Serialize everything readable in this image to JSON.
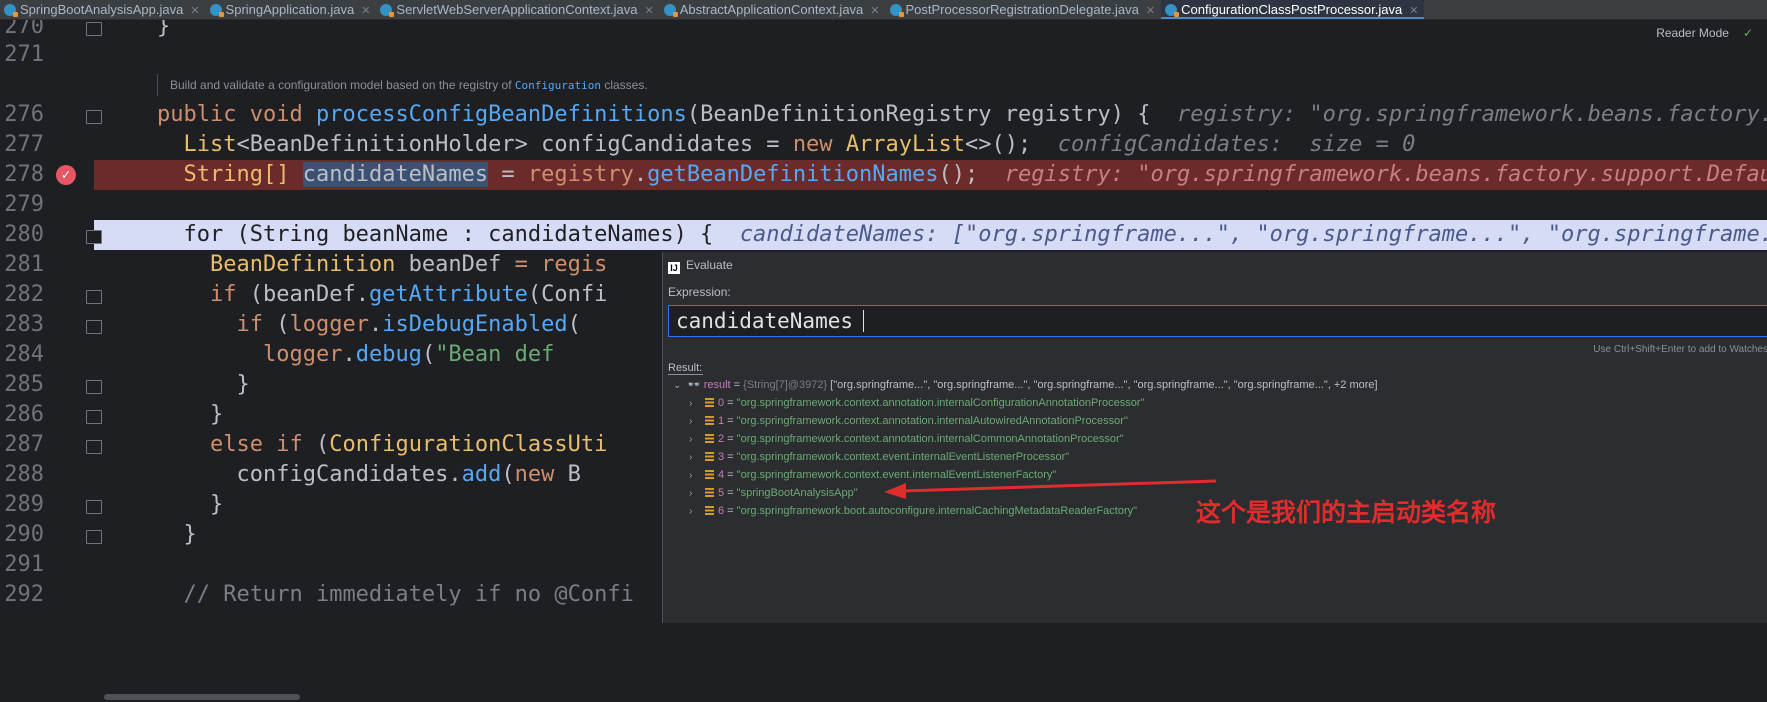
{
  "tabs": [
    {
      "label": "SpringBootAnalysisApp.java",
      "active": false
    },
    {
      "label": "SpringApplication.java",
      "active": false
    },
    {
      "label": "ServletWebServerApplicationContext.java",
      "active": false
    },
    {
      "label": "AbstractApplicationContext.java",
      "active": false
    },
    {
      "label": "PostProcessorRegistrationDelegate.java",
      "active": false
    },
    {
      "label": "ConfigurationClassPostProcessor.java",
      "active": true
    }
  ],
  "editor": {
    "reader_mode": "Reader Mode",
    "doc_comment": {
      "prefix": "Build and validate a configuration model based on the registry of",
      "code": "Configuration",
      "suffix": "classes."
    },
    "line_numbers": [
      "270",
      "271",
      "276",
      "277",
      "278",
      "279",
      "280",
      "281",
      "282",
      "283",
      "284",
      "285",
      "286",
      "287",
      "288",
      "289",
      "290",
      "291",
      "292"
    ],
    "code": {
      "l270": "}",
      "l276": {
        "kw1": "public",
        "kw2": "void",
        "fn": "processConfigBeanDefinitions",
        "p1": "(",
        "t": "BeanDefinitionRegistry",
        "param": "registry",
        "p2": ") {",
        "hint": "registry: \"org.springframework.beans.factory.support.DefaultListableBeanFactory\""
      },
      "l277": {
        "t": "List",
        "g": "<BeanDefinitionHolder>",
        "v": "configCandidates",
        "eq": " = ",
        "kw": "new",
        "cls": "ArrayList",
        "rest": "<>();",
        "hint": "configCandidates:  size = 0"
      },
      "l278": {
        "t": "String[]",
        "v": "candidateNames",
        "eq": " = ",
        "obj": "registry",
        "dot": ".",
        "fn": "getBeanDefinitionNames",
        "rest": "();",
        "hint": "registry: \"org.springframework.beans.factory.support.DefaultListableBeanFactory\""
      },
      "l280": {
        "text": "for (String beanName : candidateNames) {",
        "hint": "candidateNames: [\"org.springframe...\", \"org.springframe...\", \"org.springframe...\"]"
      },
      "l281": {
        "t": "BeanDefinition",
        "v": "beanDef",
        "rest": " = regis"
      },
      "l282": {
        "kw": "if",
        "rest1": " (beanDef.",
        "fn": "getAttribute",
        "rest2": "(Confi"
      },
      "l283": {
        "kw": "if",
        "rest1": " (",
        "obj": "logger",
        "dot": ".",
        "fn": "isDebugEnabled",
        "rest2": "("
      },
      "l284": {
        "obj": "logger",
        "dot": ".",
        "fn": "debug",
        "rest": "(",
        "str": "\"Bean def"
      },
      "l285": "}",
      "l286": "}",
      "l287": {
        "kw1": "else",
        "kw2": "if",
        "rest": " (",
        "cls": "ConfigurationClassUti"
      },
      "l288": {
        "v": "configCandidates",
        "dot": ".",
        "fn": "add",
        "rest": "(",
        "kw": "new",
        "tail": " B"
      },
      "l289": "}",
      "l290": "}",
      "l292": "// Return immediately if no @Confi"
    }
  },
  "evaluate": {
    "title": "Evaluate",
    "expression_label": "Expression:",
    "expression_value": "candidateNames",
    "use_hint": "Use Ctrl+Shift+Enter to add to Watches",
    "result_label": "Result:",
    "result": {
      "name": "result",
      "eq": " = ",
      "meta": "{String[7]@3972}",
      "value": "[\"org.springframe...\", \"org.springframe...\", \"org.springframe...\", \"org.springframe...\", \"org.springframe...\", +2 more]"
    },
    "items": [
      {
        "index": "0",
        "value": "\"org.springframework.context.annotation.internalConfigurationAnnotationProcessor\""
      },
      {
        "index": "1",
        "value": "\"org.springframework.context.annotation.internalAutowiredAnnotationProcessor\""
      },
      {
        "index": "2",
        "value": "\"org.springframework.context.annotation.internalCommonAnnotationProcessor\""
      },
      {
        "index": "3",
        "value": "\"org.springframework.context.event.internalEventListenerProcessor\""
      },
      {
        "index": "4",
        "value": "\"org.springframework.context.event.internalEventListenerFactory\""
      },
      {
        "index": "5",
        "value": "\"springBootAnalysisApp\""
      },
      {
        "index": "6",
        "value": "\"org.springframework.boot.autoconfigure.internalCachingMetadataReaderFactory\""
      }
    ]
  },
  "annotation": {
    "text": "这个是我们的主启动类名称",
    "color": "#e02c2c"
  },
  "colors": {
    "editor_bg": "#1e1f22",
    "breakpoint_line": "#6b2b2b",
    "execution_line": "#d6dcf5",
    "keyword": "#cf8e6d",
    "method": "#56a8f5",
    "string": "#6aab73"
  }
}
